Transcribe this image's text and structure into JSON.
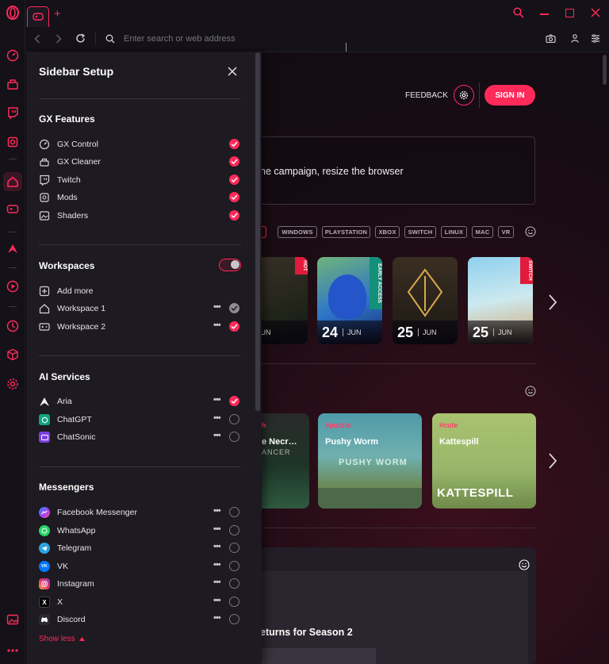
{
  "browser": {
    "address_placeholder": "Enter search or web address",
    "new_tab_symbol": "+"
  },
  "page": {
    "feedback_label": "FEEDBACK",
    "sign_in_label": "SIGN IN",
    "banner_text": "ne campaign, resize the browser",
    "platform_chips": [
      "WINDOWS",
      "PLAYSTATION",
      "XBOX",
      "SWITCH",
      "LINUX",
      "MAC",
      "VR"
    ],
    "releases": [
      {
        "day": "",
        "month": "JUN",
        "ribbon": "HOT"
      },
      {
        "day": "24",
        "month": "JUN",
        "ribbon": "EARLY ACCESS"
      },
      {
        "day": "25",
        "month": "JUN",
        "ribbon": ""
      },
      {
        "day": "25",
        "month": "JUN",
        "ribbon": "SWITCH"
      }
    ],
    "featured_games": [
      {
        "tag": "h",
        "name": "e Necr…",
        "logo_text": "ANCER"
      },
      {
        "tag": "#puzzle",
        "name": "Pushy Worm",
        "logo_text": "PUSHY WORM"
      },
      {
        "tag": "#cute",
        "name": "Kattespill",
        "logo_text": "KATTESPILL"
      }
    ],
    "news_headline": "eturns for Season 2"
  },
  "panel": {
    "title": "Sidebar Setup",
    "sections": [
      {
        "title": "GX Features",
        "items": [
          {
            "label": "GX Control",
            "icon": "gauge-icon",
            "state": "on"
          },
          {
            "label": "GX Cleaner",
            "icon": "cleaner-icon",
            "state": "on"
          },
          {
            "label": "Twitch",
            "icon": "twitch-icon",
            "state": "on"
          },
          {
            "label": "Mods",
            "icon": "mods-icon",
            "state": "on"
          },
          {
            "label": "Shaders",
            "icon": "shaders-icon",
            "state": "on"
          }
        ]
      },
      {
        "title": "Workspaces",
        "items": [
          {
            "label": "Add more",
            "icon": "plus-icon",
            "state": "none"
          },
          {
            "label": "Workspace 1",
            "icon": "home-icon",
            "state": "grey",
            "dots": "•••"
          },
          {
            "label": "Workspace 2",
            "icon": "gamepad-icon",
            "state": "on",
            "dots": "•••"
          }
        ]
      },
      {
        "title": "AI Services",
        "items": [
          {
            "label": "Aria",
            "icon": "aria-icon",
            "state": "on",
            "dots": "•••"
          },
          {
            "label": "ChatGPT",
            "icon": "chatgpt-icon",
            "state": "off",
            "dots": "•••"
          },
          {
            "label": "ChatSonic",
            "icon": "chatsonic-icon",
            "state": "off",
            "dots": "•••"
          }
        ]
      },
      {
        "title": "Messengers",
        "items": [
          {
            "label": "Facebook Messenger",
            "icon": "messenger-icon",
            "state": "off",
            "dots": "•••"
          },
          {
            "label": "WhatsApp",
            "icon": "whatsapp-icon",
            "state": "off",
            "dots": "•••"
          },
          {
            "label": "Telegram",
            "icon": "telegram-icon",
            "state": "off",
            "dots": "•••"
          },
          {
            "label": "VK",
            "icon": "vk-icon",
            "state": "off",
            "dots": "•••",
            "icon_text": "VK"
          },
          {
            "label": "Instagram",
            "icon": "instagram-icon",
            "state": "off",
            "dots": "•••"
          },
          {
            "label": "X",
            "icon": "x-icon",
            "state": "off",
            "dots": "•••",
            "icon_text": "X"
          },
          {
            "label": "Discord",
            "icon": "discord-icon",
            "state": "off",
            "dots": "•••"
          }
        ]
      }
    ],
    "workspaces_toggle": "on",
    "show_less_label": "Show less"
  },
  "colors": {
    "accent": "#ff2a5a",
    "panel_bg": "#1d1a21",
    "rail_bg": "#141118"
  }
}
